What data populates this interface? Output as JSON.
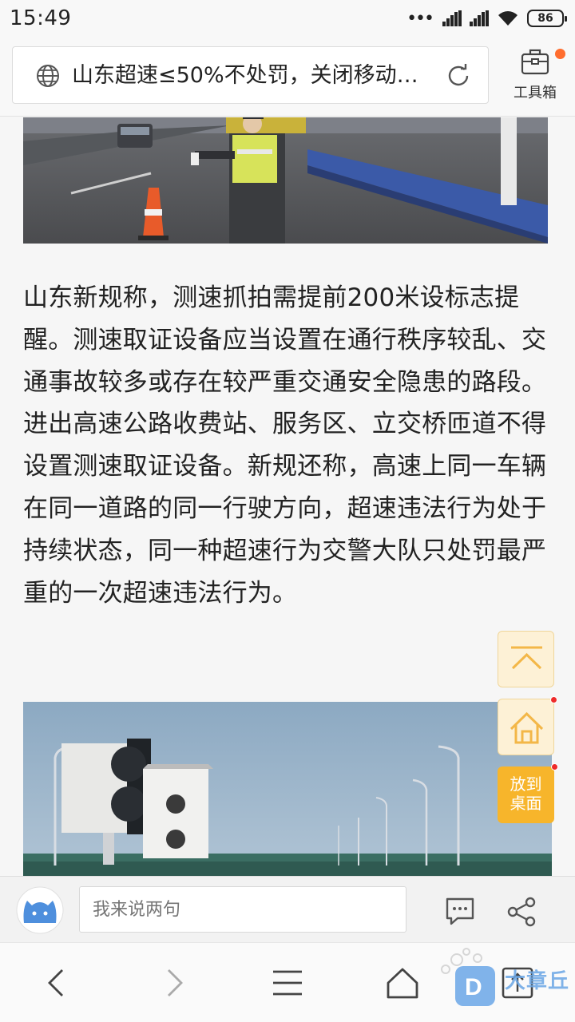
{
  "status_bar": {
    "time": "15:49",
    "battery": "86",
    "dots": "•••"
  },
  "address_bar": {
    "title": "山东超速≤50%不处罚，关闭移动…"
  },
  "toolbox": {
    "label": "工具箱"
  },
  "article": {
    "paragraph": "山东新规称，测速抓拍需提前200米设标志提醒。测速取证设备应当设置在通行秩序较乱、交通事故较多或存在较严重交通安全隐患的路段。进出高速公路收费站、服务区、立交桥匝道不得设置测速取证设备。新规还称，高速上同一车辆在同一道路的同一行驶方向，超速违法行为处于持续状态，同一种超速行为交警大队只处罚最严重的一次超速违法行为。"
  },
  "floating": {
    "desktop_label": "放到桌面"
  },
  "comment_bar": {
    "placeholder": "我来说两句"
  },
  "watermark": {
    "text": "大章丘"
  },
  "colors": {
    "accent": "#f7b52b",
    "notification": "#ff6d2e",
    "red_dot": "#ee2a2a"
  }
}
